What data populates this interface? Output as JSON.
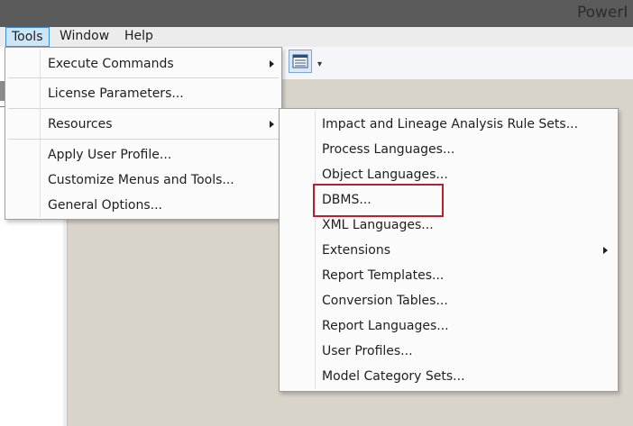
{
  "app_title": "PowerI",
  "menubar": {
    "items": [
      "Tools",
      "Window",
      "Help"
    ]
  },
  "toolbar": {
    "buttons": [
      "list-view-icon",
      "dropdown-arrow-icon"
    ]
  },
  "tools_menu": {
    "items": [
      "Execute Commands",
      "License Parameters...",
      "Resources",
      "Apply User Profile...",
      "Customize Menus and Tools...",
      "General Options..."
    ]
  },
  "resources_menu": {
    "items": [
      "Impact and Lineage Analysis Rule Sets...",
      "Process Languages...",
      "Object Languages...",
      "DBMS...",
      "XML Languages...",
      "Extensions",
      "Report Templates...",
      "Conversion Tables...",
      "Report Languages...",
      "User Profiles...",
      "Model Category Sets..."
    ]
  },
  "colors": {
    "highlight": "#b3232f",
    "active_menu": "#cde6f7"
  }
}
